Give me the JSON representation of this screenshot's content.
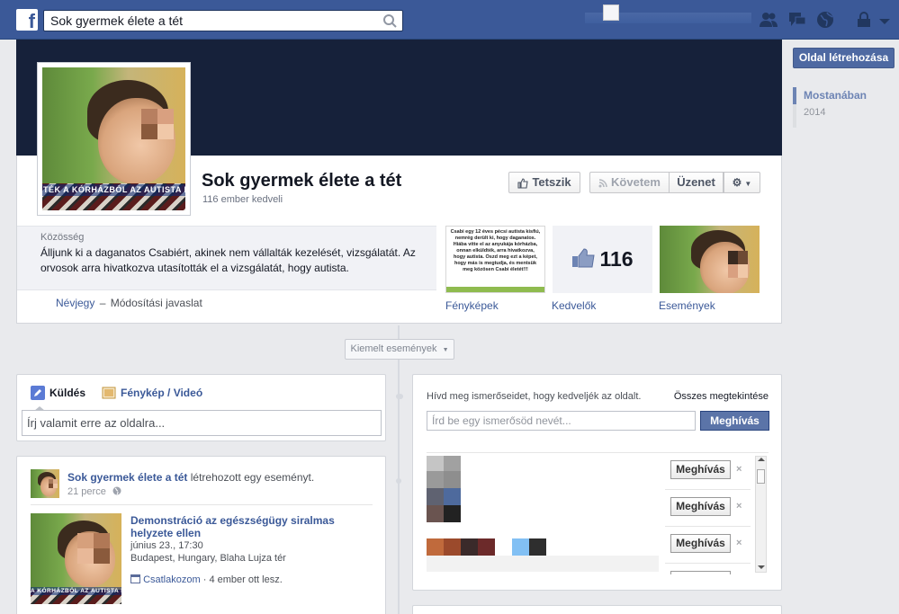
{
  "topbar": {
    "logo": "f",
    "search_value": "Sok gyermek élete a tét",
    "icons": [
      "friend-requests-icon",
      "messages-icon",
      "notifications-globe-icon",
      "privacy-lock-icon",
      "settings-caret-icon"
    ]
  },
  "page": {
    "name": "Sok gyermek élete a tét",
    "likes_line": "116 ember kedveli",
    "profile_caption": "TÉK A KÓRHÁZBÓL AZ AUTISTA KISF",
    "buttons": {
      "like": "Tetszik",
      "follow": "Követem",
      "message": "Üzenet"
    },
    "about": {
      "category": "Közösség",
      "description": "Álljunk ki a daganatos Csabiért, akinek nem vállalták kezelését, vizsgálatát. Az orvosok arra hivatkozva utasították el a vizsgálatát, hogy autista."
    },
    "links": {
      "about": "Névjegy",
      "sep": "–",
      "suggest": "Módosítási javaslat"
    },
    "tiles": {
      "photos_label": "Fényképek",
      "photo_post_text": "Csabi egy 12 éves pécsi autista kisfiú, nemrég derült ki, hogy daganatos. Hiába vitte el az anyukája kórházba, onnan elküldték, arra hivatkozva, hogy autista. Oszd meg ezt a képet, hogy más is megtudja, és mentsük meg közösen Csabi életét!!!",
      "likes_count": "116",
      "likes_label": "Kedvelők",
      "events_label": "Események"
    }
  },
  "sidebar": {
    "create_page": "Oldal létrehozása",
    "timeline": [
      {
        "label": "Mostanában",
        "active": true
      },
      {
        "label": "2014",
        "active": false
      }
    ]
  },
  "timeline": {
    "highlights_label": "Kiemelt események"
  },
  "composer": {
    "tab_post": "Küldés",
    "tab_photo": "Fénykép / Videó",
    "placeholder": "Írj valamit erre az oldalra..."
  },
  "story": {
    "author": "Sok gyermek élete a tét",
    "action": "létrehozott egy eseményt.",
    "time": "21 perce",
    "event_title": "Demonstráció az egészségügy siralmas helyzete ellen",
    "event_date": "június 23., 17:30",
    "event_place": "Budapest, Hungary, Blaha Lujza tér",
    "join": "Csatlakozom",
    "dot": "·",
    "going": "4 ember ott lesz.",
    "thumb_caption": "A KÓRHÁZBÓL AZ AUTISTA KISF"
  },
  "invite": {
    "prompt": "Hívd meg ismerőseidet, hogy kedveljék az oldalt.",
    "see_all": "Összes megtekintése",
    "placeholder": "Írd be egy ismerősöd nevét...",
    "invite_button": "Meghívás",
    "row_button": "Meghívás",
    "remove": "×"
  }
}
